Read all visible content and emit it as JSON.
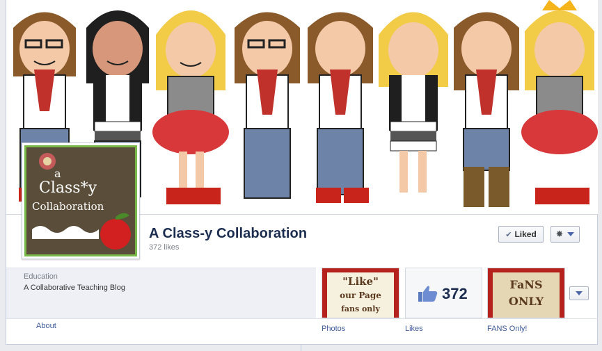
{
  "page": {
    "name": "A Class-y Collaboration",
    "likes_text": "372 likes"
  },
  "profile_picture": {
    "line1": "a",
    "line2": "Class*y",
    "line3": "Collaboration"
  },
  "actions": {
    "liked_label": "Liked",
    "check_icon": "✔",
    "gear_icon": "✸"
  },
  "info": {
    "category": "Education",
    "description": "A Collaborative Teaching Blog",
    "about_label": "About"
  },
  "apps": {
    "photos": {
      "label": "Photos",
      "line1": "\"Like\"",
      "line2": "our Page",
      "line3": "fans only"
    },
    "likes": {
      "label": "Likes",
      "count": "372"
    },
    "fans": {
      "label": "FANS Only!",
      "line1": "FaNS",
      "line2": "ONLY"
    }
  },
  "colors": {
    "brand_blue": "#3b5998",
    "title_navy": "#1c2d4f",
    "frame_red": "#b5221d"
  },
  "icons": [
    "check-icon",
    "gear-icon",
    "chevron-down-icon",
    "thumbs-up-icon"
  ]
}
